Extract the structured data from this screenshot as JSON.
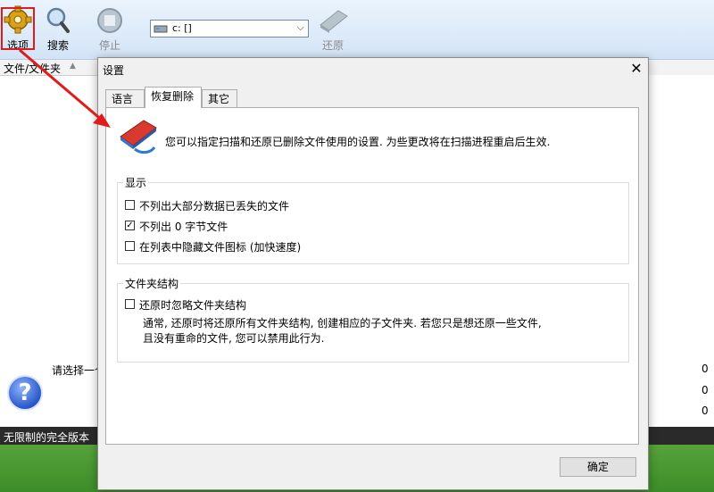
{
  "toolbar": {
    "options_label": "选项",
    "search_label": "搜索",
    "stop_label": "停止",
    "restore_label": "还原",
    "drive_value": "c: []"
  },
  "columns": {
    "file_folder": "文件/文件夹"
  },
  "main": {
    "select_prompt": "请选择一个",
    "counts": [
      "0",
      "0",
      "0"
    ]
  },
  "statusbar": {
    "text": "无限制的完全版本"
  },
  "dialog": {
    "title": "设置",
    "tabs": [
      {
        "label": "语言",
        "active": false
      },
      {
        "label": "恢复删除",
        "active": true
      },
      {
        "label": "其它",
        "active": false
      }
    ],
    "info_text": "您可以指定扫描和还原已删除文件使用的设置. 为些更改将在扫描进程重启后生效.",
    "display_group": {
      "title": "显示",
      "options": [
        {
          "label": "不列出大部分数据已丢失的文件",
          "checked": false
        },
        {
          "label": "不列出 0 字节文件",
          "checked": true
        },
        {
          "label": "在列表中隐藏文件图标 (加快速度)",
          "checked": false
        }
      ]
    },
    "folder_group": {
      "title": "文件夹结构",
      "option": {
        "label": "还原时忽略文件夹结构",
        "checked": false
      },
      "description_line1": "通常, 还原时将还原所有文件夹结构, 创建相应的子文件夹. 若您只是想还原一些文件,",
      "description_line2": "且没有重命的文件, 您可以禁用此行为."
    },
    "ok_label": "确定"
  },
  "colors": {
    "highlight": "#e01b1b",
    "arrow": "#e01b1b"
  }
}
